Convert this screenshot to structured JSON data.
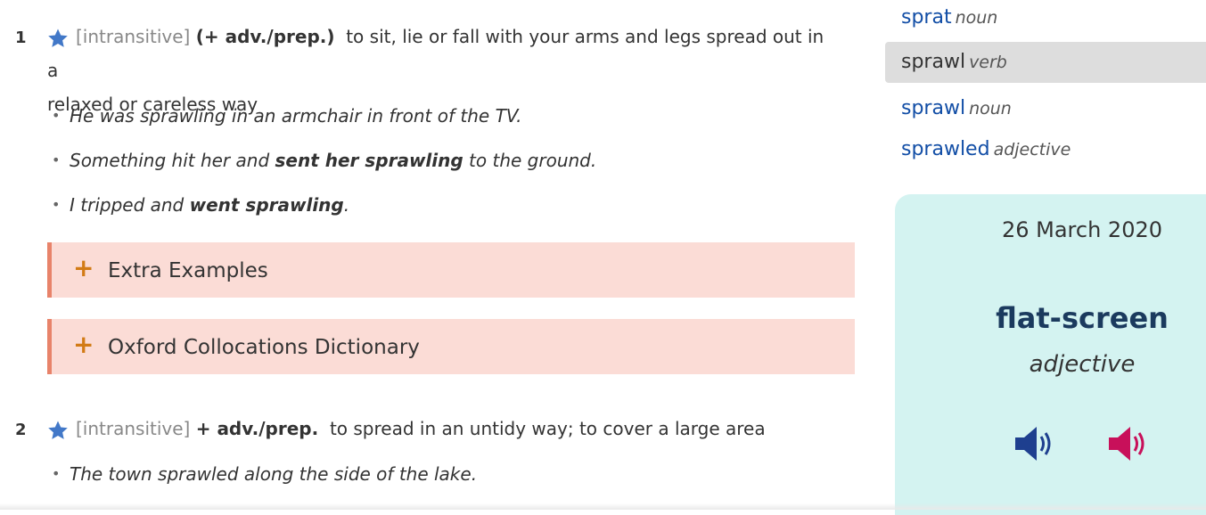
{
  "entry": {
    "senses": [
      {
        "number": "1",
        "grammar": "[intransitive]",
        "pattern": "(+ adv./prep.)",
        "definition_part1": "to sit, lie or fall with your arms and legs spread out in a",
        "definition_part2": "relaxed or careless way",
        "examples": [
          {
            "pre": "He was sprawling in an armchair in front of the TV.",
            "bold": "",
            "post": ""
          },
          {
            "pre": "Something hit her and ",
            "bold": "sent her sprawling",
            "post": " to the ground."
          },
          {
            "pre": "I tripped and ",
            "bold": "went sprawling",
            "post": "."
          }
        ],
        "unboxes": [
          {
            "icon": "+",
            "label": "Extra Examples"
          },
          {
            "icon": "+",
            "label": "Oxford Collocations Dictionary"
          }
        ]
      },
      {
        "number": "2",
        "grammar": "[intransitive]",
        "pattern": "+ adv./prep.",
        "definition": "to spread in an untidy way; to cover a large area",
        "examples": [
          {
            "pre": "The town sprawled along the side of the lake.",
            "bold": "",
            "post": ""
          }
        ]
      }
    ]
  },
  "sidebar": {
    "nearby_words": [
      {
        "word": "sprat",
        "pos": "noun",
        "selected": false
      },
      {
        "word": "sprawl",
        "pos": "verb",
        "selected": true
      },
      {
        "word": "sprawl",
        "pos": "noun",
        "selected": false
      },
      {
        "word": "sprawled",
        "pos": "adjective",
        "selected": false
      }
    ],
    "word_of_the_day": {
      "date": "26 March 2020",
      "word": "flat-screen",
      "pos": "adjective",
      "audio": [
        {
          "icon": "speaker-uk-icon",
          "color": "#1e3f8f"
        },
        {
          "icon": "speaker-us-icon",
          "color": "#c8105a"
        }
      ]
    }
  },
  "colors": {
    "link": "#124ea6",
    "star": "#4278c8",
    "unbox_bg": "#fbdcd6",
    "unbox_border": "#e8836a",
    "plus": "#d27b16",
    "wotd_bg": "#d4f3f1"
  }
}
